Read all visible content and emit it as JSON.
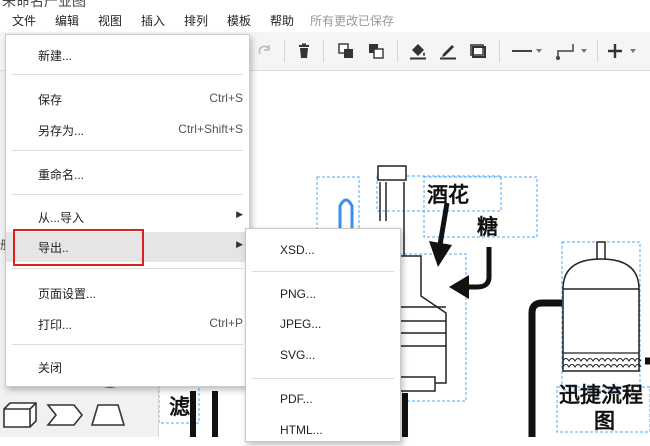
{
  "window": {
    "title": "未命名产业图"
  },
  "menubar": {
    "items": [
      "文件",
      "编辑",
      "视图",
      "插入",
      "排列",
      "模板",
      "帮助"
    ],
    "status": "所有更改已保存"
  },
  "file_menu": {
    "new": "新建...",
    "save": "保存",
    "save_shortcut": "Ctrl+S",
    "save_as": "另存为...",
    "save_as_shortcut": "Ctrl+Shift+S",
    "rename": "重命名...",
    "import_from": "从...导入",
    "export": "导出..",
    "page_setup": "页面设置...",
    "print": "打印...",
    "print_shortcut": "Ctrl+P",
    "close": "关闭"
  },
  "export_submenu": {
    "items": [
      "XSD...",
      "PNG...",
      "JPEG...",
      "SVG...",
      "PDF...",
      "HTML..."
    ]
  },
  "sidebar": {
    "partial_label": "册"
  },
  "canvas": {
    "label_hops": "酒花",
    "label_sugar": "糖",
    "label_filter": "滤",
    "label_title_line1": "迅捷流程",
    "label_title_line2": "图"
  },
  "colors": {
    "highlight_box": "#e02020",
    "selection": "#4aa8ff",
    "accent_blue": "#3b8ee8"
  }
}
